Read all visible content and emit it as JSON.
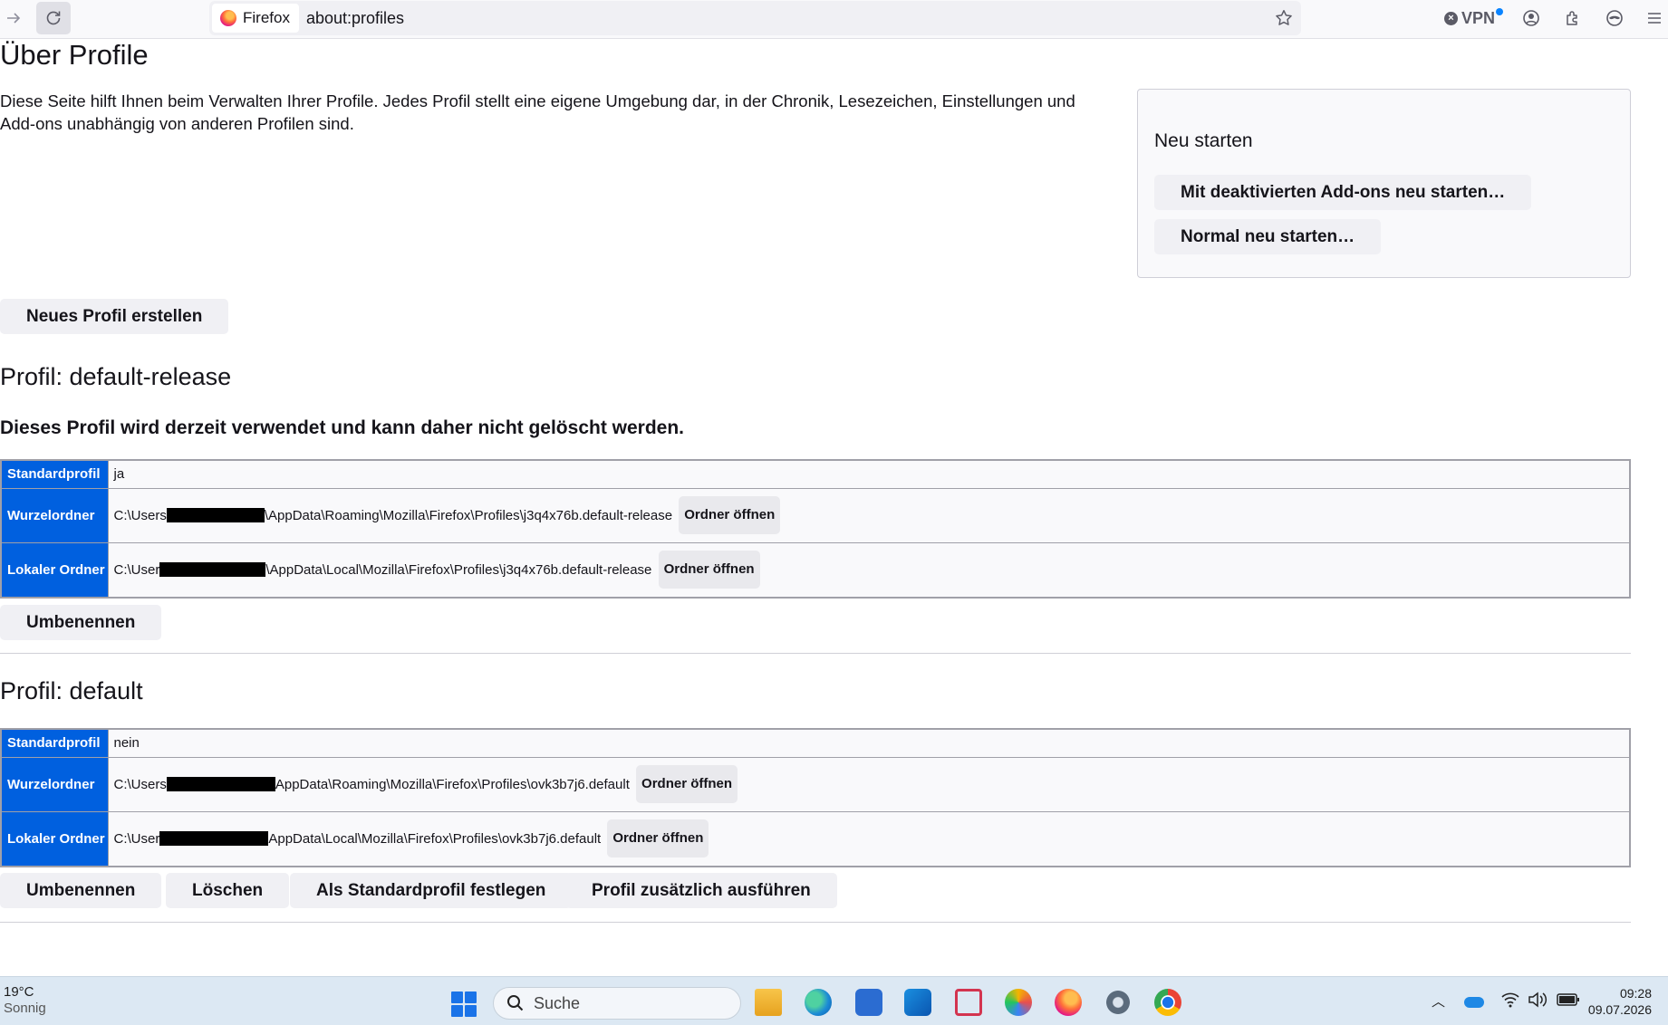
{
  "browser": {
    "identity_label": "Firefox",
    "url": "about:profiles",
    "vpn_label": "VPN"
  },
  "page": {
    "title": "Über Profile",
    "intro": "Diese Seite hilft Ihnen beim Verwalten Ihrer Profile. Jedes Profil stellt eine eigene Umgebung dar, in der Chronik, Lesezeichen, Einstellungen und Add-ons unabhängig von anderen Profilen sind.",
    "restart": {
      "heading": "Neu starten",
      "addons_button": "Mit deaktivierten Add-ons neu starten…",
      "normal_button": "Normal neu starten…"
    },
    "create_button": "Neues Profil erstellen",
    "profiles": [
      {
        "heading": "Profil: default-release",
        "note": "Dieses Profil wird derzeit verwendet und kann daher nicht gelöscht werden.",
        "default_label": "Standardprofil",
        "default_value": "ja",
        "root_label": "Wurzelordner",
        "root_prefix": "C:\\Users",
        "root_suffix": "\\AppData\\Roaming\\Mozilla\\Firefox\\Profiles\\j3q4x76b.default-release",
        "local_label": "Lokaler Ordner",
        "local_prefix": "C:\\User",
        "local_suffix": "\\AppData\\Local\\Mozilla\\Firefox\\Profiles\\j3q4x76b.default-release",
        "open_label": "Ordner öffnen",
        "rename_button": "Umbenennen"
      },
      {
        "heading": "Profil: default",
        "default_label": "Standardprofil",
        "default_value": "nein",
        "root_label": "Wurzelordner",
        "root_prefix": "C:\\Users",
        "root_suffix": "AppData\\Roaming\\Mozilla\\Firefox\\Profiles\\ovk3b7j6.default",
        "local_label": "Lokaler Ordner",
        "local_prefix": "C:\\User",
        "local_suffix": "AppData\\Local\\Mozilla\\Firefox\\Profiles\\ovk3b7j6.default",
        "open_label": "Ordner öffnen",
        "rename_button": "Umbenennen",
        "delete_button": "Löschen",
        "set_default_button": "Als Standardprofil festlegen",
        "launch_button": "Profil zusätzlich ausführen"
      }
    ]
  },
  "taskbar": {
    "temperature": "19°C",
    "condition": "Sonnig",
    "search_placeholder": "Suche",
    "time": "09:28",
    "date": "09.07.2026",
    "apps": [
      "file-explorer-icon",
      "edge-icon",
      "store-icon",
      "outlook-icon",
      "snipping-tool-icon",
      "paint-icon",
      "firefox-icon",
      "settings-icon",
      "chrome-icon"
    ]
  }
}
